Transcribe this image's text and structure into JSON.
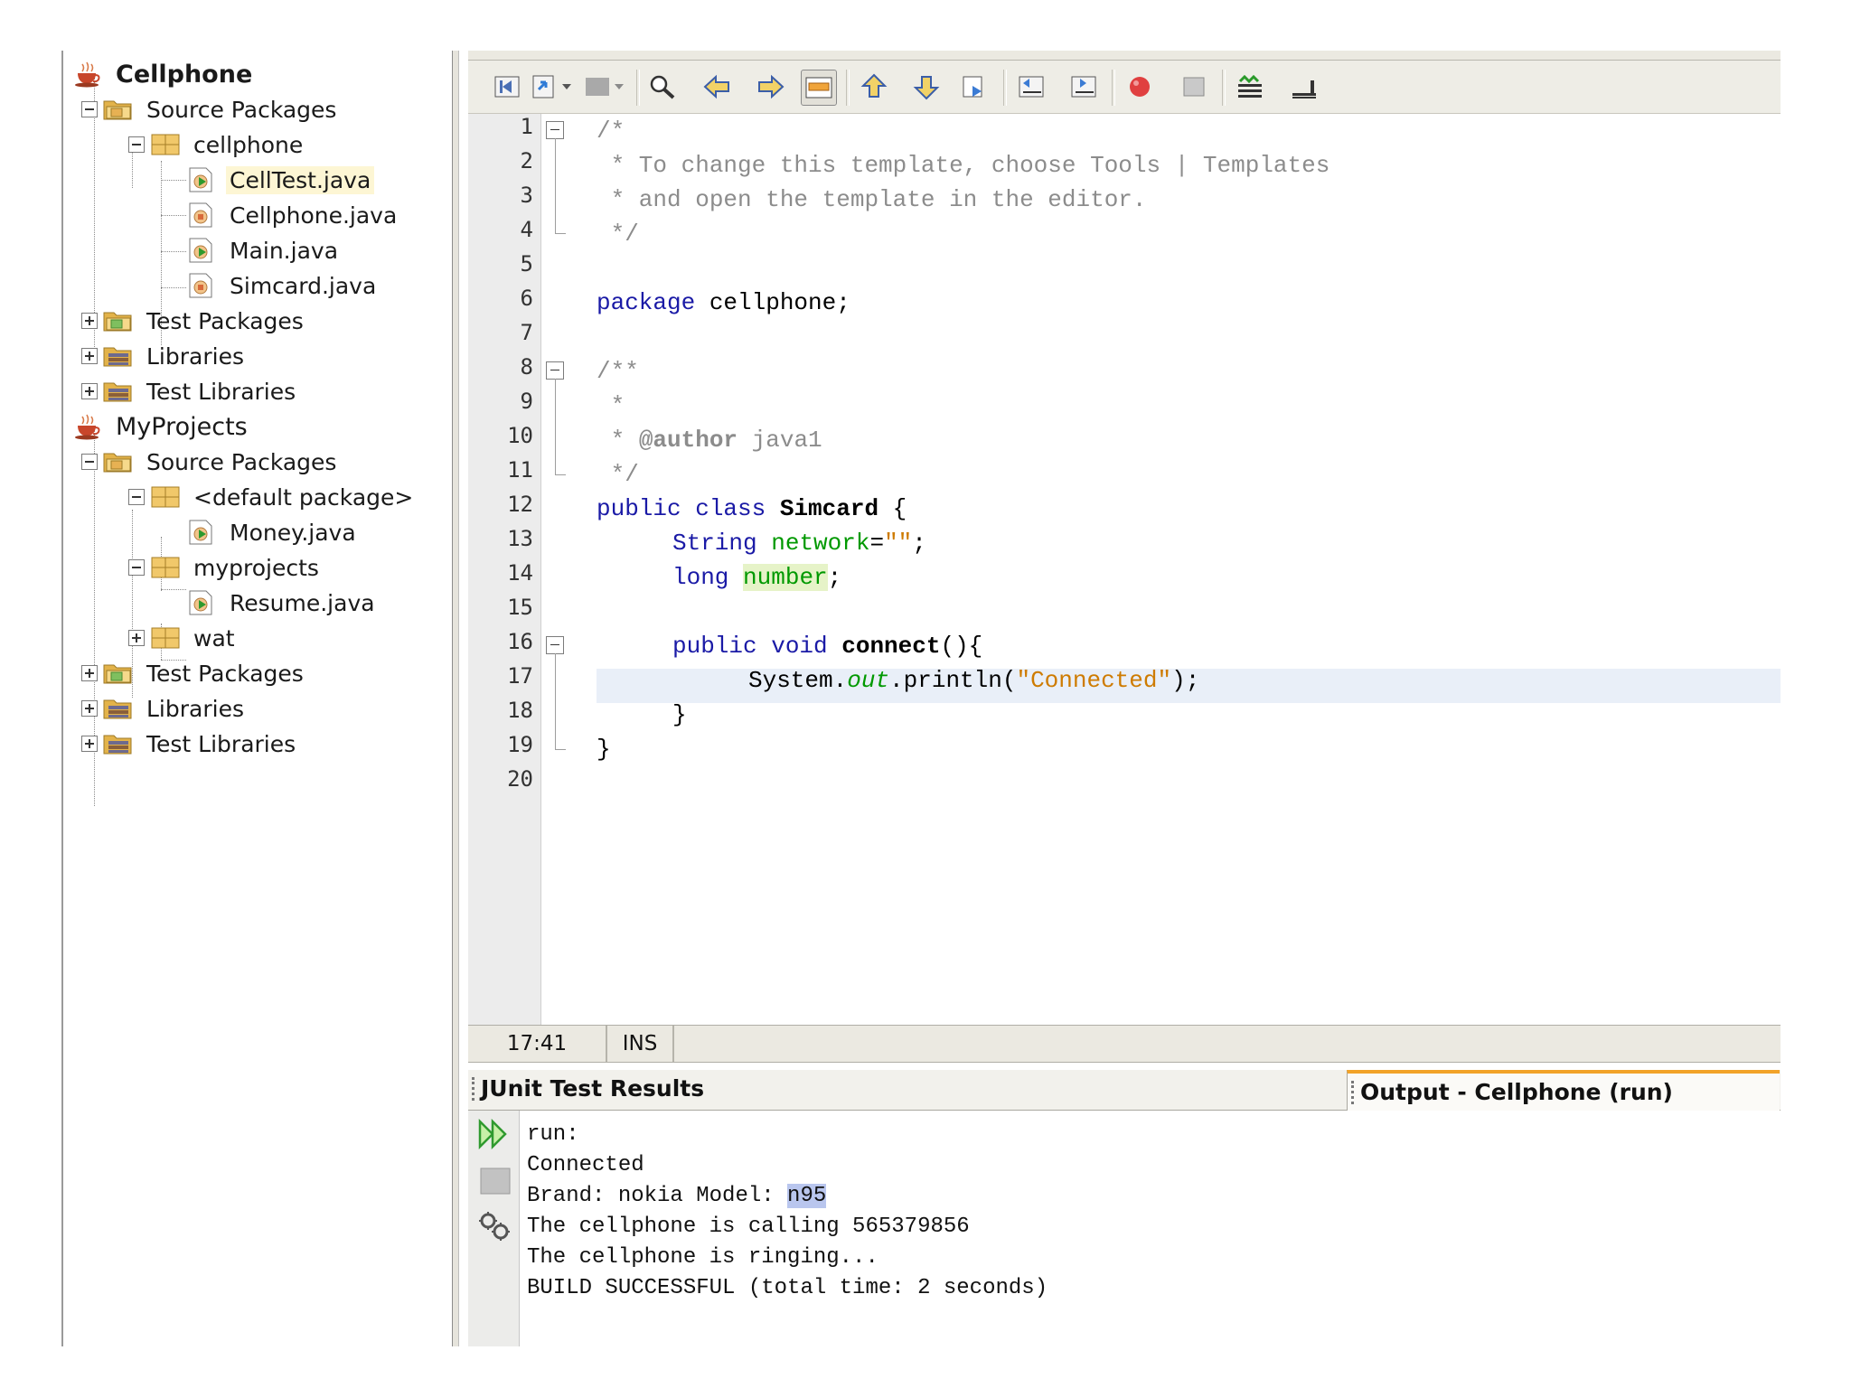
{
  "tree": {
    "nodes": [
      {
        "label": "Cellphone",
        "type": "project"
      },
      {
        "label": "Source Packages",
        "type": "folder"
      },
      {
        "label": "cellphone",
        "type": "package"
      },
      {
        "label": "CellTest.java",
        "type": "file"
      },
      {
        "label": "Cellphone.java",
        "type": "file"
      },
      {
        "label": "Main.java",
        "type": "file"
      },
      {
        "label": "Simcard.java",
        "type": "file"
      },
      {
        "label": "Test Packages",
        "type": "folder"
      },
      {
        "label": "Libraries",
        "type": "library"
      },
      {
        "label": "Test Libraries",
        "type": "library"
      },
      {
        "label": "MyProjects",
        "type": "project"
      },
      {
        "label": "Source Packages",
        "type": "folder"
      },
      {
        "label": "<default package>",
        "type": "package"
      },
      {
        "label": "Money.java",
        "type": "file"
      },
      {
        "label": "myprojects",
        "type": "package"
      },
      {
        "label": "Resume.java",
        "type": "file"
      },
      {
        "label": "wat",
        "type": "package"
      },
      {
        "label": "Test Packages",
        "type": "folder"
      },
      {
        "label": "Libraries",
        "type": "library"
      },
      {
        "label": "Test Libraries",
        "type": "library"
      }
    ]
  },
  "editor": {
    "line_numbers": [
      "1",
      "2",
      "3",
      "4",
      "5",
      "6",
      "7",
      "8",
      "9",
      "10",
      "11",
      "12",
      "13",
      "14",
      "15",
      "16",
      "17",
      "18",
      "19",
      "20"
    ],
    "code": {
      "l1": "/*",
      "l2": " * To change this template, choose Tools | Templates",
      "l3": " * and open the template in the editor.",
      "l4": " */",
      "l6_kw": "package",
      "l6_rest": " cellphone;",
      "l8": "/**",
      "l9": " *",
      "l10_star": " * ",
      "l10_tag": "@author",
      "l10_rest": " java1",
      "l11": " */",
      "l12_kw": "public class",
      "l12_sp": " ",
      "l12_name": "Simcard",
      "l12_rest": " {",
      "l13_type": "String",
      "l13_sp": " ",
      "l13_field": "network",
      "l13_eq": "=",
      "l13_str": "\"\"",
      "l13_end": ";",
      "l14_kw": "long",
      "l14_sp": " ",
      "l14_field": "number",
      "l14_end": ";",
      "l16_kw": "public void",
      "l16_sp": " ",
      "l16_name": "connect",
      "l16_rest": "(){",
      "l17_a": "System.",
      "l17_out": "out",
      "l17_b": ".println(",
      "l17_str": "\"Connected\"",
      "l17_c": ");",
      "l18": "}",
      "l19": "}"
    }
  },
  "status": {
    "position": "17:41",
    "mode": "INS"
  },
  "output": {
    "tabs": {
      "junit": "JUnit Test Results",
      "output": "Output - Cellphone (run)"
    },
    "lines": {
      "l1": "run:",
      "l2": "Connected",
      "l3a": "Brand: nokia Model: ",
      "l3b": "n95",
      "l4": "The cellphone is calling 565379856",
      "l5": "The cellphone is ringing...",
      "l6": "BUILD SUCCESSFUL (total time: 2 seconds)"
    }
  },
  "colors": {
    "keyword": "#1a1aa6",
    "comment": "#8c8c8c",
    "field": "#009900",
    "string": "#ce7b00",
    "active_tab": "#f2a329",
    "highlight": "#e6f3c8"
  }
}
